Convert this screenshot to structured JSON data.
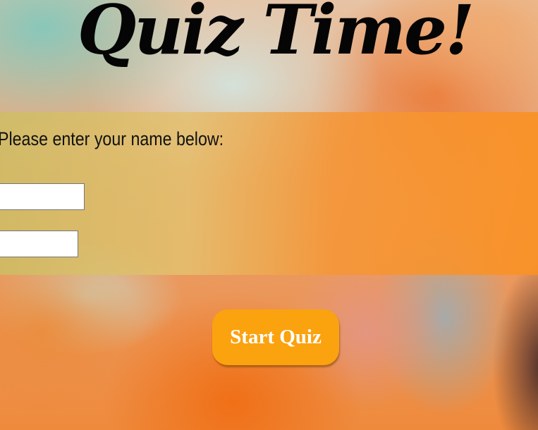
{
  "page": {
    "title": "Quiz Time!"
  },
  "form": {
    "prompt": "Please enter your name below:",
    "first_input": {
      "value": "",
      "placeholder": ""
    },
    "second_input": {
      "value": "",
      "placeholder": ""
    }
  },
  "actions": {
    "start_label": "Start Quiz"
  },
  "colors": {
    "title_text": "#050505",
    "button_background": "#fba20f",
    "button_text": "#ffffff",
    "band_left": "#cdbe64",
    "band_right": "#fa9123"
  }
}
